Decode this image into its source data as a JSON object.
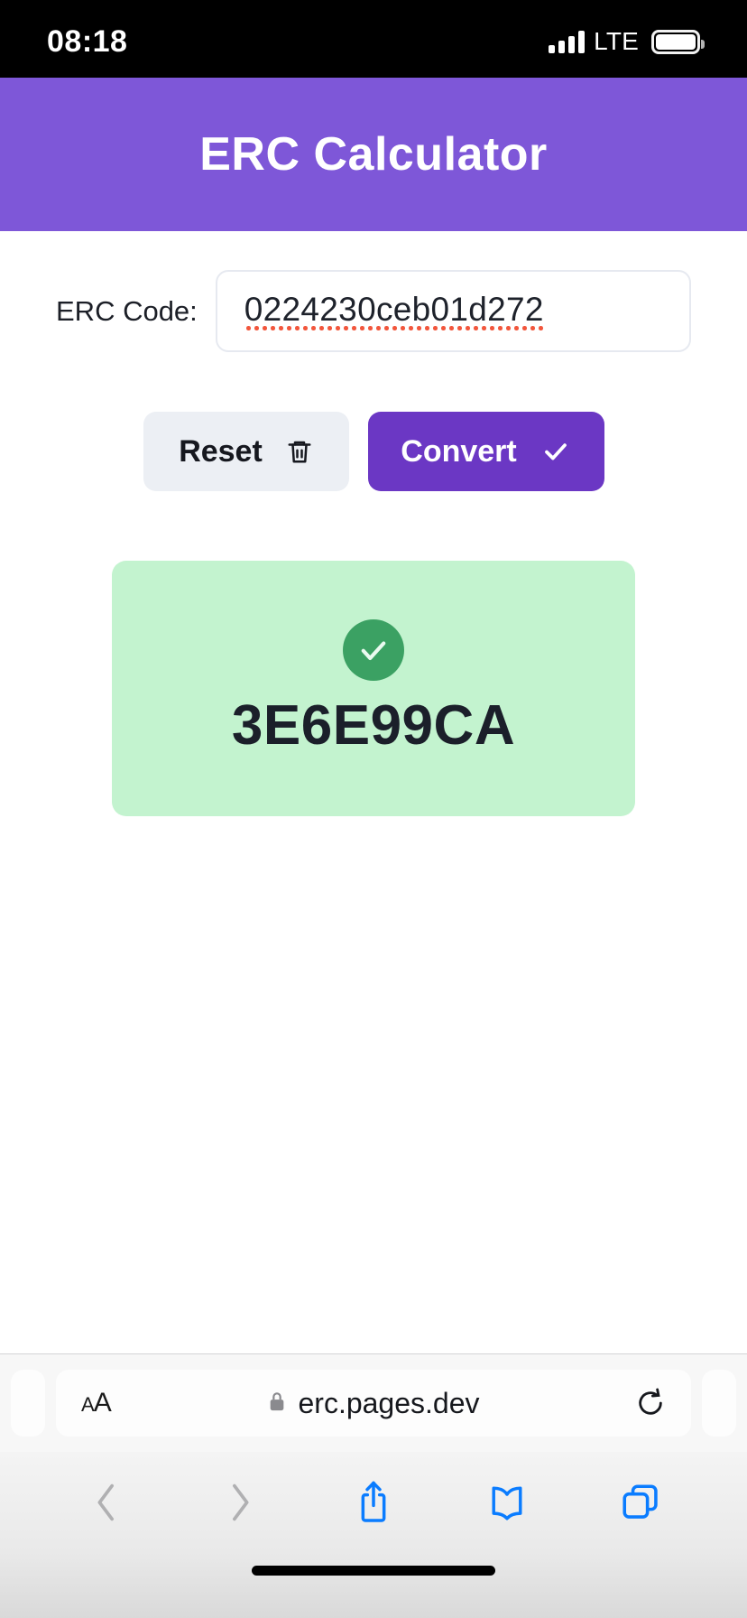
{
  "status_bar": {
    "time": "08:18",
    "network": "LTE",
    "signal_icon": "signal-bars-icon",
    "battery_icon": "battery-full-icon"
  },
  "app": {
    "title": "ERC Calculator",
    "header_color": "#7e57d8"
  },
  "form": {
    "label": "ERC Code:",
    "input_value": "0224230ceb01d272",
    "input_placeholder": "",
    "spellcheck_underline": true
  },
  "buttons": {
    "reset_label": "Reset",
    "reset_icon": "trash-icon",
    "reset_color": "#eceff4",
    "convert_label": "Convert",
    "convert_icon": "check-icon",
    "convert_color": "#6b37c4"
  },
  "result": {
    "status_icon": "check-circle-icon",
    "code": "3E6E99CA",
    "card_color": "#c3f3cf",
    "icon_color": "#3ba163"
  },
  "browser": {
    "text_size_label_small": "A",
    "text_size_label_large": "A",
    "lock_icon": "lock-icon",
    "url": "erc.pages.dev",
    "reload_icon": "reload-icon",
    "toolbar": [
      {
        "name": "back-button",
        "icon": "chevron-left-icon",
        "enabled": false
      },
      {
        "name": "forward-button",
        "icon": "chevron-right-icon",
        "enabled": false
      },
      {
        "name": "share-button",
        "icon": "share-icon",
        "enabled": true
      },
      {
        "name": "bookmarks-button",
        "icon": "book-icon",
        "enabled": true
      },
      {
        "name": "tabs-button",
        "icon": "tabs-icon",
        "enabled": true
      }
    ],
    "accent_color": "#0a7cff"
  }
}
